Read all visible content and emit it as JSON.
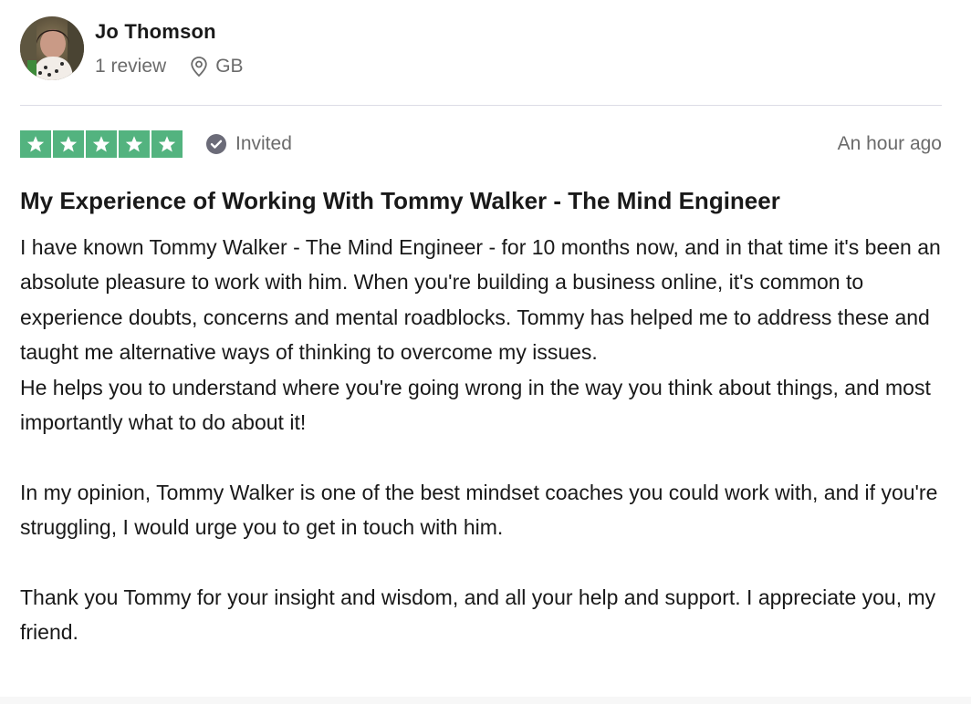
{
  "reviewer": {
    "name": "Jo Thomson",
    "review_count": "1 review",
    "location": "GB",
    "avatar_icon": "avatar-photo"
  },
  "rating": {
    "stars": 5,
    "max_stars": 5,
    "star_color": "#53b37f",
    "verification_label": "Invited",
    "verification_icon": "check-circle-icon",
    "date": "An hour ago"
  },
  "review": {
    "title": "My Experience of Working With Tommy Walker - The Mind Engineer",
    "paragraphs": [
      "I have known Tommy Walker - The Mind Engineer - for 10 months now, and in that time it's been an absolute pleasure to work with him. When you're building a business online, it's common to experience doubts, concerns and mental roadblocks. Tommy has helped me to address these and taught me alternative ways of thinking to overcome my issues.",
      "He helps you to understand where you're going wrong in the way you think about things, and most importantly what to do about it!",
      "In my opinion, Tommy Walker is one of the best mindset coaches you could work with, and if you're struggling, I would urge you to get in touch with him.",
      "Thank you Tommy for your insight and wisdom, and all your help and support. I appreciate you, my friend."
    ]
  }
}
